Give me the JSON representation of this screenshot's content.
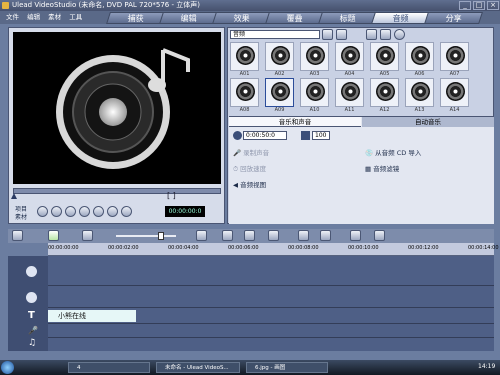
{
  "window": {
    "title": "Ulead VideoStudio (未命名, DVD PAL 720*576 - 立体声)"
  },
  "menu": {
    "file": "文件",
    "edit": "编辑",
    "clip": "素材",
    "tools": "工具"
  },
  "steps": [
    "捕获",
    "编辑",
    "效果",
    "覆叠",
    "标题",
    "音频",
    "分享"
  ],
  "library": {
    "category": "音频",
    "items": [
      "A01",
      "A02",
      "A03",
      "A04",
      "A05",
      "A06",
      "A07",
      "A08",
      "A09",
      "A10",
      "A11",
      "A12",
      "A13",
      "A14"
    ]
  },
  "options": {
    "tab_music": "音乐和声音",
    "tab_auto": "自动音乐",
    "duration": "0:00:50:0",
    "volume": "100",
    "record_voice": "录制声音",
    "playback_speed": "回放速度",
    "audio_view": "音频视图",
    "import_cd": "从音频 CD 导入",
    "audio_filter": "音频滤镜"
  },
  "player": {
    "project_label": "项目",
    "clip_label": "素材",
    "timecode": "00:00:00:0"
  },
  "timeline": {
    "ticks": [
      "00:00:00:00",
      "00:00:02:00",
      "00:00:04:00",
      "00:00:06:00",
      "00:00:08:00",
      "00:00:10:00",
      "00:00:12:00",
      "00:00:14:00"
    ],
    "title_clip": "小熊在线"
  },
  "taskbar": {
    "btn1": "4",
    "btn2": "未命名 - Ulead VideoS...",
    "btn3": "6.jpg - 画图",
    "clock": "14:19"
  },
  "colors": {
    "accent": "#3c4f79",
    "track": "#4e5f86",
    "title_clip": "#e6f7f7"
  }
}
